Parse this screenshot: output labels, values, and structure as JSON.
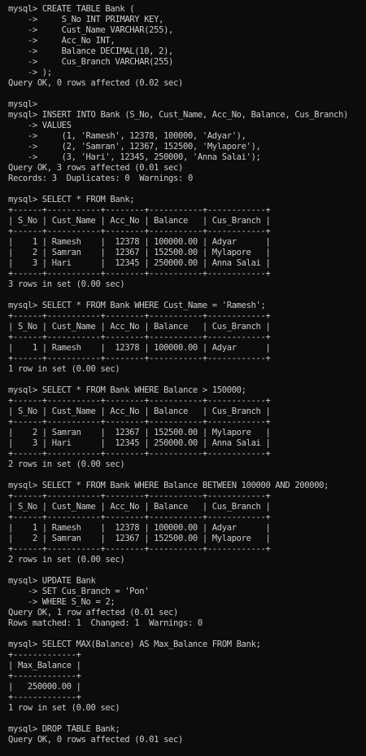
{
  "terminal": {
    "lines": [
      "mysql> CREATE TABLE Bank (",
      "    ->     S_No INT PRIMARY KEY,",
      "    ->     Cust_Name VARCHAR(255),",
      "    ->     Acc_No INT,",
      "    ->     Balance DECIMAL(10, 2),",
      "    ->     Cus_Branch VARCHAR(255)",
      "    -> );",
      "Query OK, 0 rows affected (0.02 sec)",
      "",
      "mysql>",
      "mysql> INSERT INTO Bank (S_No, Cust_Name, Acc_No, Balance, Cus_Branch)",
      "    -> VALUES",
      "    ->     (1, 'Ramesh', 12378, 100000, 'Adyar'),",
      "    ->     (2, 'Samran', 12367, 152500, 'Mylapore'),",
      "    ->     (3, 'Hari', 12345, 250000, 'Anna Salai');",
      "Query OK, 3 rows affected (0.01 sec)",
      "Records: 3  Duplicates: 0  Warnings: 0",
      "",
      "mysql> SELECT * FROM Bank;",
      "+------+-----------+--------+-----------+------------+",
      "| S_No | Cust_Name | Acc_No | Balance   | Cus_Branch |",
      "+------+-----------+--------+-----------+------------+",
      "|    1 | Ramesh    |  12378 | 100000.00 | Adyar      |",
      "|    2 | Samran    |  12367 | 152500.00 | Mylapore   |",
      "|    3 | Hari      |  12345 | 250000.00 | Anna Salai |",
      "+------+-----------+--------+-----------+------------+",
      "3 rows in set (0.00 sec)",
      "",
      "mysql> SELECT * FROM Bank WHERE Cust_Name = 'Ramesh';",
      "+------+-----------+--------+-----------+------------+",
      "| S_No | Cust_Name | Acc_No | Balance   | Cus_Branch |",
      "+------+-----------+--------+-----------+------------+",
      "|    1 | Ramesh    |  12378 | 100000.00 | Adyar      |",
      "+------+-----------+--------+-----------+------------+",
      "1 row in set (0.00 sec)",
      "",
      "mysql> SELECT * FROM Bank WHERE Balance > 150000;",
      "+------+-----------+--------+-----------+------------+",
      "| S_No | Cust_Name | Acc_No | Balance   | Cus_Branch |",
      "+------+-----------+--------+-----------+------------+",
      "|    2 | Samran    |  12367 | 152500.00 | Mylapore   |",
      "|    3 | Hari      |  12345 | 250000.00 | Anna Salai |",
      "+------+-----------+--------+-----------+------------+",
      "2 rows in set (0.00 sec)",
      "",
      "mysql> SELECT * FROM Bank WHERE Balance BETWEEN 100000 AND 200000;",
      "+------+-----------+--------+-----------+------------+",
      "| S_No | Cust_Name | Acc_No | Balance   | Cus_Branch |",
      "+------+-----------+--------+-----------+------------+",
      "|    1 | Ramesh    |  12378 | 100000.00 | Adyar      |",
      "|    2 | Samran    |  12367 | 152500.00 | Mylapore   |",
      "+------+-----------+--------+-----------+------------+",
      "2 rows in set (0.00 sec)",
      "",
      "mysql> UPDATE Bank",
      "    -> SET Cus_Branch = 'Pon'",
      "    -> WHERE S_No = 2;",
      "Query OK, 1 row affected (0.01 sec)",
      "Rows matched: 1  Changed: 1  Warnings: 0",
      "",
      "mysql> SELECT MAX(Balance) AS Max_Balance FROM Bank;",
      "+-------------+",
      "| Max_Balance |",
      "+-------------+",
      "|   250000.00 |",
      "+-------------+",
      "1 row in set (0.00 sec)",
      "",
      "mysql> DROP TABLE Bank;",
      "Query OK, 0 rows affected (0.01 sec)"
    ]
  },
  "colors": {
    "background": "#0c0c0c",
    "text": "#cccccc"
  }
}
